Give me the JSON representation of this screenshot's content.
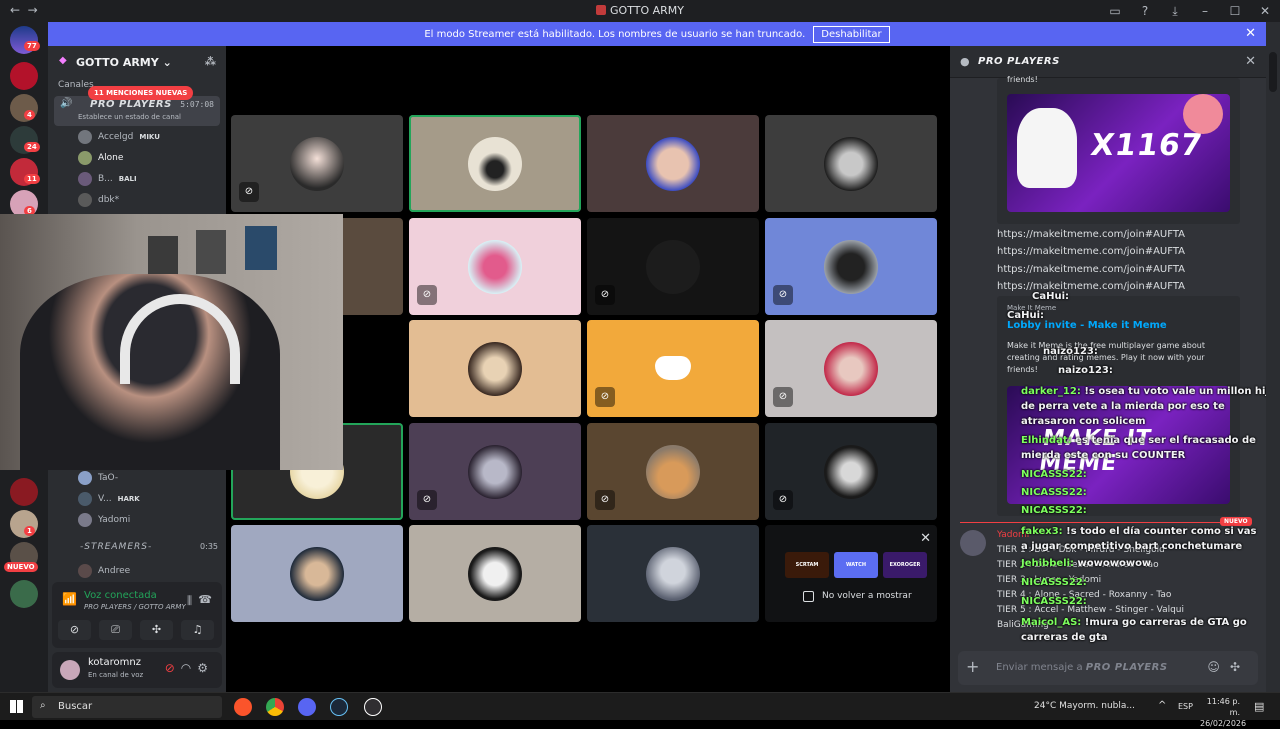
{
  "window": {
    "title": "GOTTO ARMY"
  },
  "banner": {
    "text": "El modo Streamer está habilitado. Los nombres de usuario se han truncado.",
    "button": "Deshabilitar"
  },
  "servers": {
    "badges": [
      "77",
      "4",
      "24",
      "11",
      "6",
      "1",
      "NUEVO"
    ]
  },
  "sidebar": {
    "guild": "GOTTO ARMY",
    "section": "Canales",
    "mentions": "11 MENCIONES NUEVAS",
    "channel": {
      "name": "PRO PLAYERS",
      "time": "5:07:08",
      "status": "Establece un estado de canal"
    },
    "users_top": [
      {
        "name": "Accelgd",
        "tag": "MIKU"
      },
      {
        "name": "Alone",
        "tag": ""
      },
      {
        "name": "B...",
        "tag": "BALI"
      },
      {
        "name": "dbk*",
        "tag": ""
      }
    ],
    "users_bottom": [
      {
        "name": "TaO-",
        "tag": ""
      },
      {
        "name": "V...",
        "tag": "HARK"
      },
      {
        "name": "Yadomi",
        "tag": ""
      }
    ],
    "category2": {
      "name": "-STREAMERS-",
      "time": "0:35"
    },
    "andree": "Andree",
    "voice": {
      "status": "Voz conectada",
      "channel": "PRO PLAYERS / GOTTO ARMY"
    },
    "user": {
      "name": "kotaromnz",
      "status": "En canal de voz"
    }
  },
  "promo": {
    "checkbox": "No volver a mostrar",
    "games": [
      "SCRTAM",
      "WATCH",
      "EXOROGER"
    ]
  },
  "chat": {
    "channel": "PRO PLAYERS",
    "partial": "friends!",
    "meme_text": "X1167",
    "meme_text2": "MAKE IT MEME",
    "links": [
      "https://makeitmeme.com/join#AUFTA",
      "https://makeitmeme.com/join#AUFTA",
      "https://makeitmeme.com/join#AUFTA",
      "https://makeitmeme.com/join#AUFTA"
    ],
    "embed_title": "Lobby invite - Make it Meme",
    "embed_site": "Make It Meme",
    "embed_desc": "Make it Meme is the free multiplayer game about creating and rating memes. Play it now with your friends!",
    "overlay": [
      {
        "user": "CaHui:",
        "text": ""
      },
      {
        "user": "CaHui:",
        "text": ""
      },
      {
        "user": "naizo123:",
        "text": ""
      },
      {
        "user": "naizo123:",
        "text": ""
      },
      {
        "user": "darker_12:",
        "text": "!s osea tu voto vale un millon hijo de perra vete a la mierda por eso te atrasaron con solicem"
      },
      {
        "user": "Elhindat:",
        "text": "es tenia que ser el fracasado de mierda este con su COUNTER"
      },
      {
        "user": "NICASSS22:",
        "text": ""
      },
      {
        "user": "NICASSS22:",
        "text": ""
      },
      {
        "user": "NICASSS22:",
        "text": ""
      },
      {
        "user": "fakex3:",
        "text": "!s todo el día counter como si vas a jugar competitivo bart conchetumare"
      },
      {
        "user": "Jehibbeli:",
        "text": "wowowowow"
      },
      {
        "user": "NICASSS22:",
        "text": ""
      },
      {
        "user": "NICASSS22:",
        "text": ""
      },
      {
        "user": "Maicol_AS:",
        "text": "!mura go carreras de GTA go carreras de gta"
      }
    ],
    "new_badge": "NUEVO",
    "author": "Yadomi",
    "tiers": [
      "TIER 1 : Bot - Dbk - Miruru - Shellgold",
      "TIER 2 : Zona - Sebas - Andree - Tao",
      "TIER 3 : Lunar - Yadomi",
      "TIER 4 : Alone - Sacred - Roxanny - Tao",
      "TIER 5 : Accel - Matthew - Stinger - Valqui",
      "BaliGaming"
    ],
    "input_placeholder": "Enviar mensaje a",
    "input_channel": "PRO PLAYERS"
  },
  "taskbar": {
    "search": "Buscar",
    "weather": "24°C  Mayorm. nubla...",
    "lang": "ESP",
    "time": "11:46 p. m.",
    "date": "26/02/2026"
  }
}
